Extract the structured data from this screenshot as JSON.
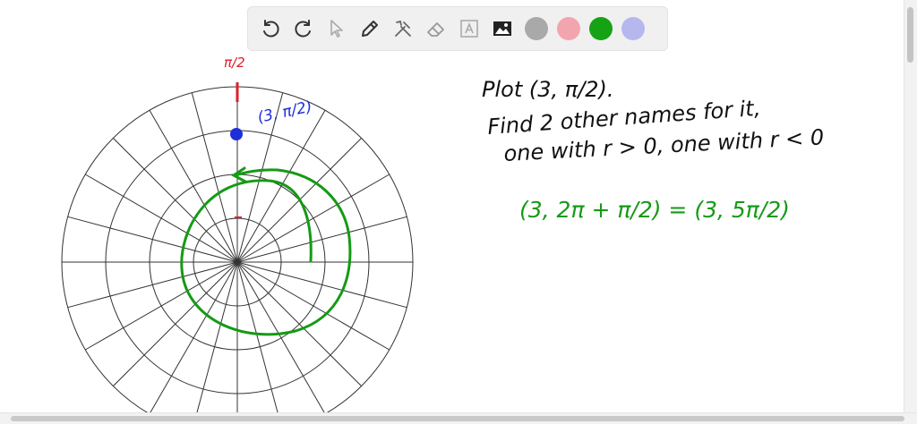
{
  "toolbar": {
    "tools": [
      {
        "name": "undo-icon"
      },
      {
        "name": "redo-icon"
      },
      {
        "name": "select-pointer-icon"
      },
      {
        "name": "pen-icon"
      },
      {
        "name": "tools-icon"
      },
      {
        "name": "eraser-icon"
      },
      {
        "name": "text-icon"
      },
      {
        "name": "image-icon"
      }
    ],
    "colors": [
      "#a9a9a9",
      "#f2a5ae",
      "#15a315",
      "#b7b7ef"
    ]
  },
  "ink": {
    "red": "#dd1f2a",
    "blue": "#1f2fd8",
    "green": "#159a15",
    "black": "#111111"
  },
  "annotations": {
    "angle_label": "π/2",
    "point_label": "(3, π/2)",
    "green_expression": "(3, 2π + π/2) = (3, 5π/2)",
    "instructions": [
      "Plot (3, π/2).",
      "Find 2 other names for it,",
      "one with r > 0, one with r < 0"
    ]
  }
}
